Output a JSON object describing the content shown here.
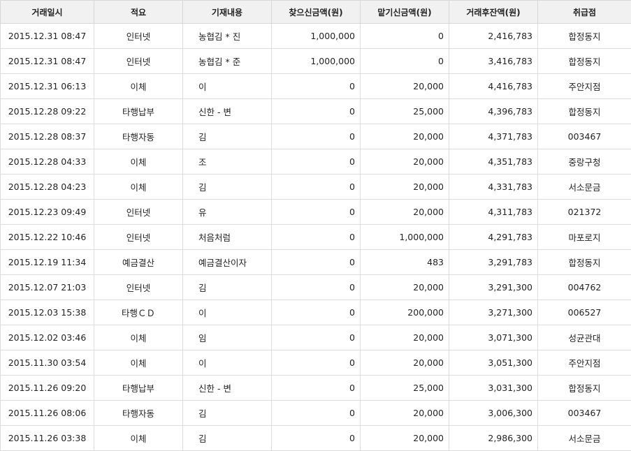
{
  "columns": [
    "거래일시",
    "적요",
    "기재내용",
    "찾으신금액(원)",
    "맡기신금액(원)",
    "거래후잔액(원)",
    "취급점"
  ],
  "rows": [
    [
      "2015.12.31 08:47",
      "인터넷",
      "농협김 * 진",
      "1,000,000",
      "0",
      "2,416,783",
      "합정동지"
    ],
    [
      "2015.12.31 08:47",
      "인터넷",
      "농협김 * 준",
      "1,000,000",
      "0",
      "3,416,783",
      "합정동지"
    ],
    [
      "2015.12.31 06:13",
      "이체",
      "이",
      "0",
      "20,000",
      "4,416,783",
      "주안지점"
    ],
    [
      "2015.12.28 09:22",
      "타행납부",
      "신한 - 변",
      "0",
      "25,000",
      "4,396,783",
      "합정동지"
    ],
    [
      "2015.12.28 08:37",
      "타행자동",
      "김",
      "0",
      "20,000",
      "4,371,783",
      "003467"
    ],
    [
      "2015.12.28 04:33",
      "이체",
      "조",
      "0",
      "20,000",
      "4,351,783",
      "중랑구청"
    ],
    [
      "2015.12.28 04:23",
      "이체",
      "김",
      "0",
      "20,000",
      "4,331,783",
      "서소문금"
    ],
    [
      "2015.12.23 09:49",
      "인터넷",
      "유",
      "0",
      "20,000",
      "4,311,783",
      "021372"
    ],
    [
      "2015.12.22 10:46",
      "인터넷",
      "처음처럼",
      "0",
      "1,000,000",
      "4,291,783",
      "마포로지"
    ],
    [
      "2015.12.19 11:34",
      "예금결산",
      "예금결산이자",
      "0",
      "483",
      "3,291,783",
      "합정동지"
    ],
    [
      "2015.12.07 21:03",
      "인터넷",
      "김",
      "0",
      "20,000",
      "3,291,300",
      "004762"
    ],
    [
      "2015.12.03 15:38",
      "타행ＣＤ",
      "이",
      "0",
      "200,000",
      "3,271,300",
      "006527"
    ],
    [
      "2015.12.02 03:46",
      "이체",
      "임",
      "0",
      "20,000",
      "3,071,300",
      "성균관대"
    ],
    [
      "2015.11.30 03:54",
      "이체",
      "이",
      "0",
      "20,000",
      "3,051,300",
      "주안지점"
    ],
    [
      "2015.11.26 09:20",
      "타행납부",
      "신한 - 변",
      "0",
      "25,000",
      "3,031,300",
      "합정동지"
    ],
    [
      "2015.11.26 08:06",
      "타행자동",
      "김",
      "0",
      "20,000",
      "3,006,300",
      "003467"
    ],
    [
      "2015.11.26 03:38",
      "이체",
      "김",
      "0",
      "20,000",
      "2,986,300",
      "서소문금"
    ]
  ]
}
